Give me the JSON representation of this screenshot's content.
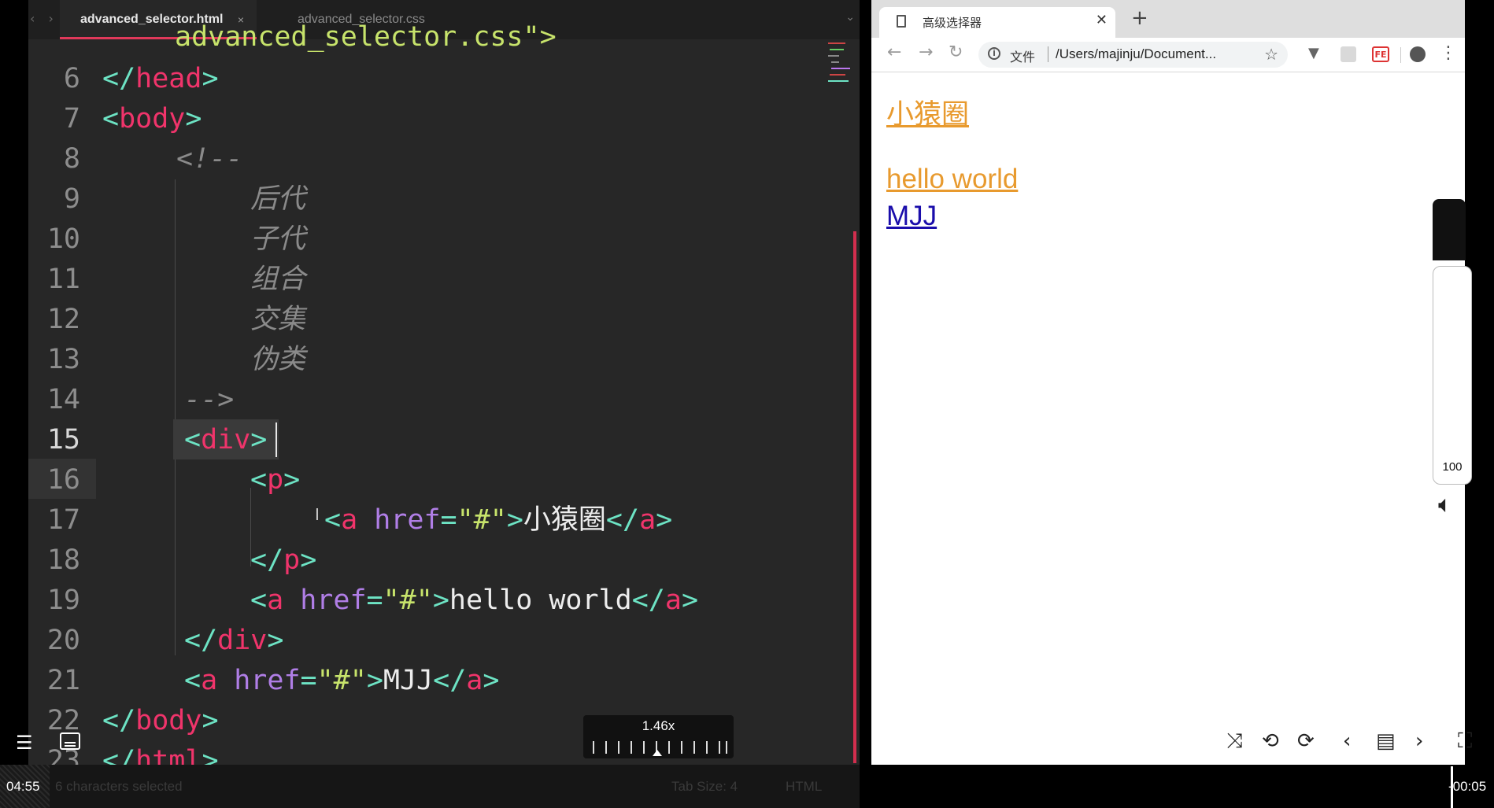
{
  "editor": {
    "tabs": [
      {
        "label": "advanced_selector.html",
        "active": true
      },
      {
        "label": "advanced_selector.css",
        "active": false
      }
    ],
    "tab_close": "×",
    "nav_arrows": "‹ ›",
    "partial_top_line": "advanced_selector.css\">",
    "line_numbers": [
      "6",
      "7",
      "8",
      "9",
      "10",
      "11",
      "12",
      "13",
      "14",
      "15",
      "16",
      "17",
      "18",
      "19",
      "20",
      "21",
      "22",
      "23"
    ],
    "current_line": "15",
    "comment_items": [
      "后代",
      "子代",
      "组合",
      "交集",
      "伪类"
    ],
    "comment_open": "<!--",
    "comment_close": "-->",
    "status_selection": "6 characters selected",
    "status_tab_size": "Tab Size: 4",
    "status_syntax": "HTML"
  },
  "code": {
    "head_close": "head",
    "body_tag": "body",
    "div_tag": "div",
    "p_tag": "p",
    "a_tag": "a",
    "href_attr": "href",
    "href_value": "\"#\"",
    "link1_text": "小猿圈",
    "link2_text": "hello world",
    "link3_text": "MJJ",
    "html_tag": "html"
  },
  "browser": {
    "tab_title": "高级选择器",
    "tab_close": "✕",
    "new_tab": "+",
    "omnibox_scheme": "文件",
    "omnibox_url": "/Users/majinju/Document...",
    "ext_fe": "FE",
    "page_links": [
      {
        "text": "小猿圈",
        "visited": true
      },
      {
        "text": "hello world",
        "visited": true
      },
      {
        "text": "MJJ",
        "visited": false
      }
    ]
  },
  "player": {
    "time_elapsed": "04:55",
    "time_remaining": "-00:05",
    "speed": "1.46x",
    "volume": "100"
  },
  "colors": {
    "editor_bg": "#272727",
    "tag": "#f0346b",
    "punct": "#6de3c4",
    "attr": "#b07ee6",
    "string": "#c7e36b",
    "visited_link": "#e89a2e",
    "link": "#1a0dab",
    "accent_tab": "#e0395a"
  },
  "icons": [
    "back-arrow-icon",
    "forward-arrow-icon",
    "reload-icon",
    "info-icon",
    "star-icon",
    "extension-icon",
    "profile-icon",
    "menu-dots-icon",
    "hamburger-icon",
    "subtitle-icon",
    "speaker-icon",
    "shuffle-icon",
    "repeat-icon",
    "repeat-one-icon",
    "previous-icon",
    "playlist-icon",
    "next-icon",
    "fullscreen-icon"
  ]
}
